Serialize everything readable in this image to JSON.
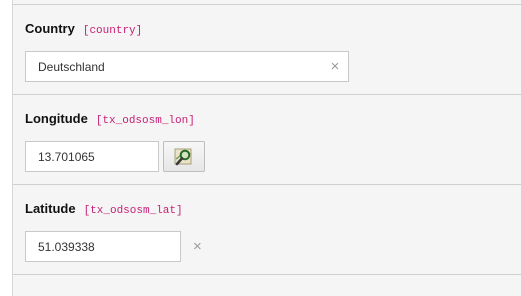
{
  "fields": [
    {
      "label": "Country",
      "key": "[country]",
      "value": "Deutschland",
      "clear_icon": "close-icon"
    },
    {
      "label": "Longitude",
      "key": "[tx_odsosm_lon]",
      "value": "13.701065",
      "clear_icon": "close-icon",
      "action_icon": "map-search-icon"
    },
    {
      "label": "Latitude",
      "key": "[tx_odsosm_lat]",
      "value": "51.039338",
      "clear_icon": "close-icon"
    }
  ],
  "clear_glyph": "×",
  "colors": {
    "panel_background": "#f5f5f5",
    "field_key": "#c61f74",
    "divider": "#cfcfcf"
  }
}
